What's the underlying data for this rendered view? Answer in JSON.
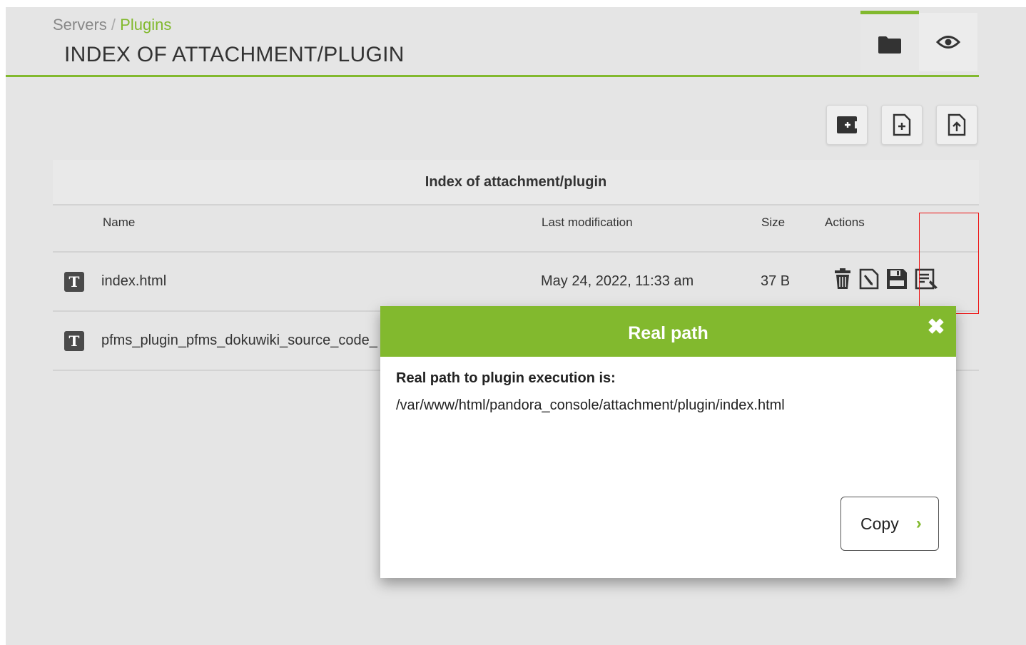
{
  "breadcrumb": {
    "root": "Servers",
    "separator": "/",
    "current": "Plugins"
  },
  "page_title": "INDEX OF ATTACHMENT/PLUGIN",
  "header_tabs": [
    {
      "icon": "folder-icon",
      "active": true
    },
    {
      "icon": "eye-icon",
      "active": false
    }
  ],
  "toolbar_icons": [
    "create-folder-icon",
    "create-file-icon",
    "upload-file-icon"
  ],
  "table": {
    "caption": "Index of attachment/plugin",
    "columns": {
      "name": "Name",
      "modified": "Last modification",
      "size": "Size",
      "actions": "Actions"
    },
    "rows": [
      {
        "name": "index.html",
        "modified": "May 24, 2022, 11:33 am",
        "size": "37 B"
      },
      {
        "name": "pfms_plugin_pfms_dokuwiki_source_code_",
        "modified": "",
        "size": ""
      }
    ]
  },
  "dialog": {
    "title": "Real path",
    "close": "✖",
    "label": "Real path to plugin execution is:",
    "path": "/var/www/html/pandora_console/attachment/plugin/index.html",
    "copy_label": "Copy",
    "copy_chevron": "›"
  },
  "colors": {
    "accent": "#82b92e",
    "background": "#e5e5e5",
    "highlight": "#ee1111"
  }
}
